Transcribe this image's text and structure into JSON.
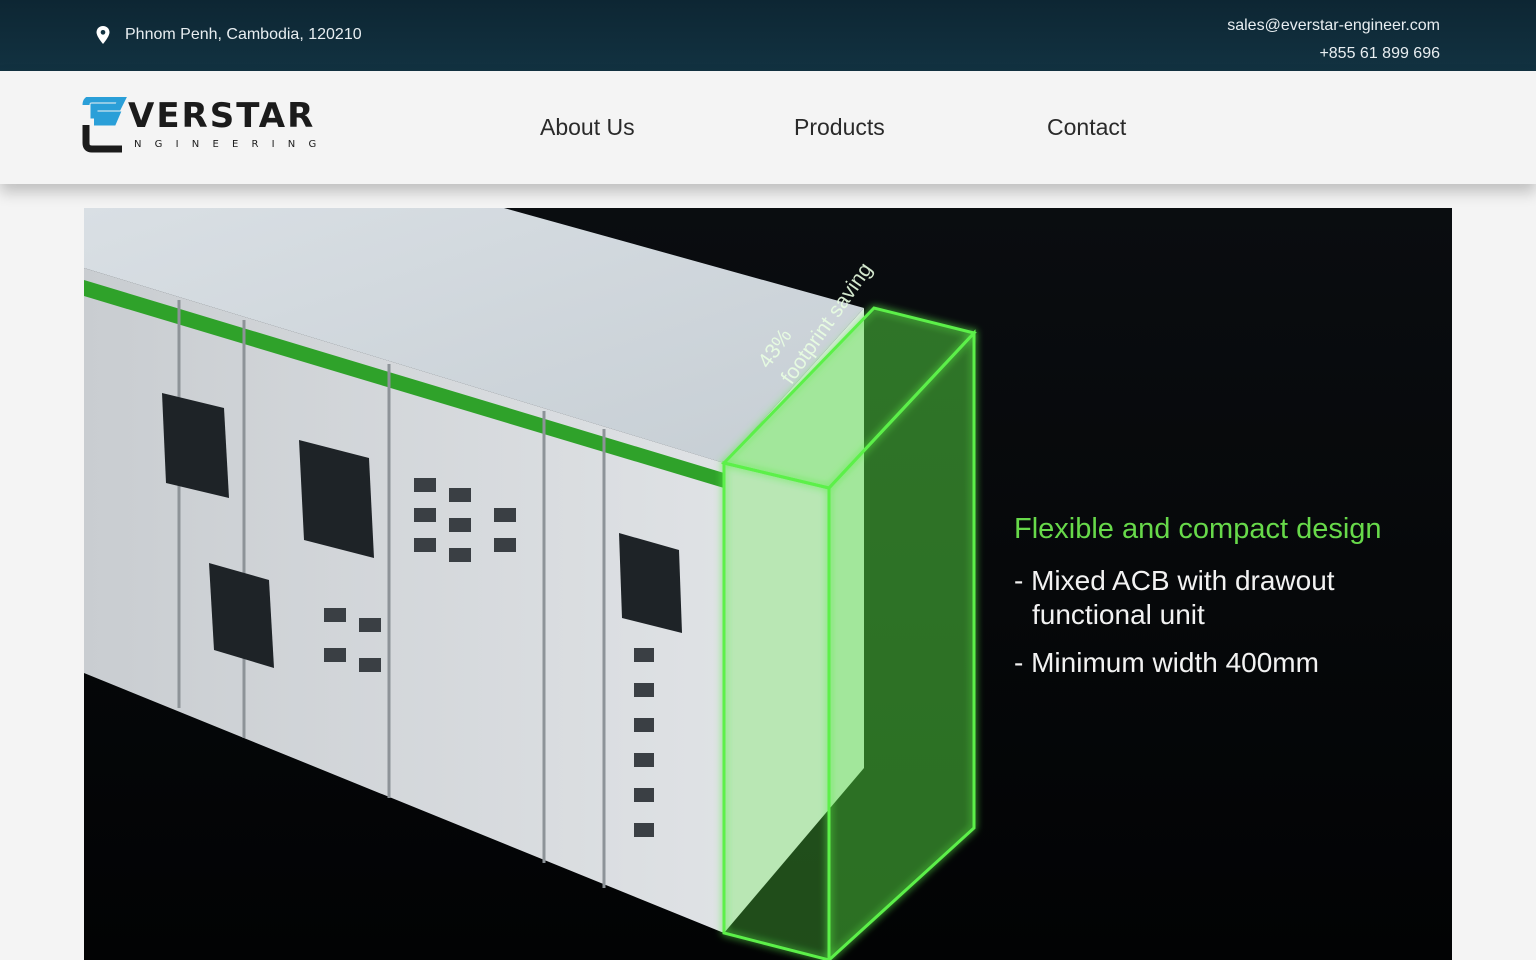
{
  "topbar": {
    "location": "Phnom Penh, Cambodia, 120210",
    "email": "sales@everstar-engineer.com",
    "phone": "+855 61 899 696",
    "pin_icon": "map-pin-icon"
  },
  "brand": {
    "logo_top": "VERSTAR",
    "logo_bottom": "NGINEERING",
    "colors": {
      "accent": "#2a9fd8",
      "dark": "#1b1b1b"
    }
  },
  "nav": {
    "about": "About Us",
    "products": "Products",
    "contact": "Contact"
  },
  "hero": {
    "badge_percent": "43%",
    "badge_text": "footprint saving",
    "headline": "Flexible and compact design",
    "bullets": [
      "- Mixed ACB with drawout",
      "functional unit",
      "- Minimum width 400mm"
    ],
    "colors": {
      "green": "#67d94a",
      "background": "#05080a"
    }
  }
}
